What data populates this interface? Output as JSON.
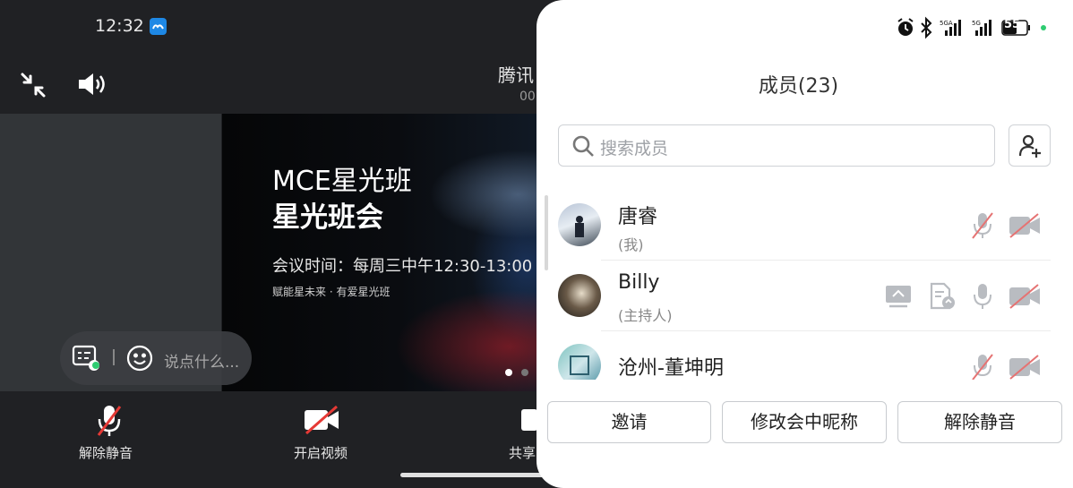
{
  "status_bar": {
    "time": "12:32",
    "battery": "55"
  },
  "meeting": {
    "title": "腾讯",
    "subtitle": "00"
  },
  "share": {
    "title_line1": "MCE星光班",
    "title_line2": "星光班会",
    "time_text": "会议时间：每周三中午12:30-13:00",
    "slogan": "赋能星未来 · 有爱星光班",
    "page_dots": 2,
    "active_dot": 0
  },
  "chat": {
    "placeholder": "说点什么..."
  },
  "bottom_bar": {
    "unmute_label": "解除静音",
    "video_label": "开启视频",
    "share_label": "共享"
  },
  "members_panel": {
    "title": "成员(23)",
    "search_placeholder": "搜索成员",
    "members": [
      {
        "name": "唐睿",
        "role": "(我)",
        "mic": "muted",
        "camera": "off"
      },
      {
        "name": "Billy",
        "role": "(主持人)",
        "mic": "on",
        "camera": "off",
        "sharing": true,
        "doc": true
      },
      {
        "name": "沧州-董坤明",
        "role": "",
        "mic": "muted",
        "camera": "off"
      }
    ],
    "buttons": {
      "invite": "邀请",
      "rename": "修改会中昵称",
      "unmute": "解除静音"
    }
  },
  "icons": [
    "exit-fullscreen-icon",
    "speaker-icon",
    "chat-icon",
    "emoji-icon",
    "mic-muted-icon",
    "camera-off-icon",
    "share-screen-icon",
    "search-icon",
    "add-member-icon",
    "alarm-icon",
    "bluetooth-icon",
    "signal-icon",
    "battery-icon"
  ],
  "colors": {
    "accent_green": "#2ecc71",
    "muted_red": "#e53935",
    "panel_bg": "#ffffff"
  }
}
